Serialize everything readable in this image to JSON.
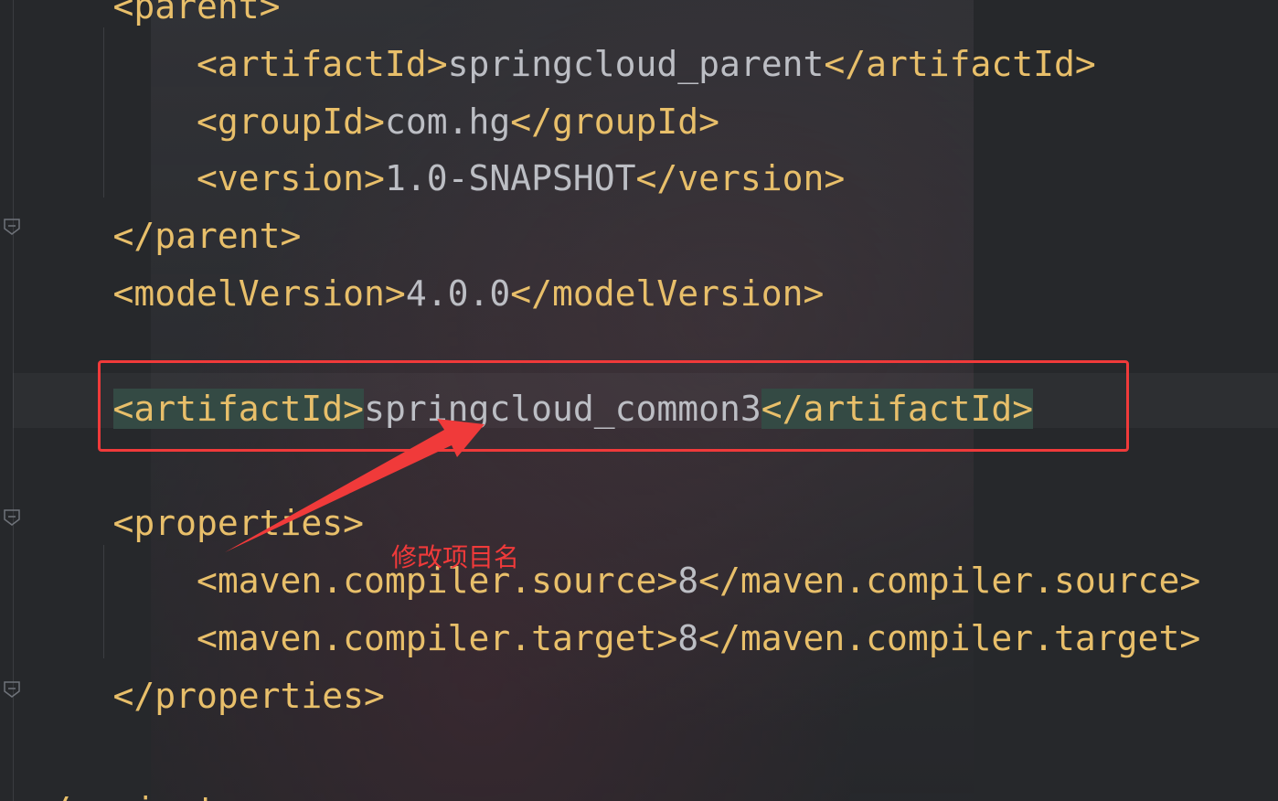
{
  "editor": {
    "lines": [
      {
        "indent": "    ",
        "parts": [
          {
            "t": "<parent>",
            "k": "tag"
          }
        ]
      },
      {
        "indent": "        ",
        "parts": [
          {
            "t": "<artifactId>",
            "k": "tag"
          },
          {
            "t": "springcloud_parent",
            "k": "val"
          },
          {
            "t": "</artifactId>",
            "k": "tag"
          }
        ]
      },
      {
        "indent": "        ",
        "parts": [
          {
            "t": "<groupId>",
            "k": "tag"
          },
          {
            "t": "com.hg",
            "k": "val"
          },
          {
            "t": "</groupId>",
            "k": "tag"
          }
        ]
      },
      {
        "indent": "        ",
        "parts": [
          {
            "t": "<version>",
            "k": "tag"
          },
          {
            "t": "1.0-SNAPSHOT",
            "k": "val"
          },
          {
            "t": "</version>",
            "k": "tag"
          }
        ]
      },
      {
        "indent": "    ",
        "parts": [
          {
            "t": "</parent>",
            "k": "tag"
          }
        ]
      },
      {
        "indent": "    ",
        "parts": [
          {
            "t": "<modelVersion>",
            "k": "tag"
          },
          {
            "t": "4.0.0",
            "k": "val"
          },
          {
            "t": "</modelVersion>",
            "k": "tag"
          }
        ]
      },
      {
        "indent": "",
        "parts": []
      },
      {
        "indent": "    ",
        "parts": [
          {
            "t": "<artifactId>",
            "k": "tag hl-tag"
          },
          {
            "t": "springcloud_common3",
            "k": "val"
          },
          {
            "t": "</artifactId>",
            "k": "tag hl-tag"
          }
        ]
      },
      {
        "indent": "",
        "parts": []
      },
      {
        "indent": "    ",
        "parts": [
          {
            "t": "<properties>",
            "k": "tag"
          }
        ]
      },
      {
        "indent": "        ",
        "parts": [
          {
            "t": "<maven.compiler.source>",
            "k": "tag"
          },
          {
            "t": "8",
            "k": "val"
          },
          {
            "t": "</maven.compiler.source>",
            "k": "tag"
          }
        ]
      },
      {
        "indent": "        ",
        "parts": [
          {
            "t": "<maven.compiler.target>",
            "k": "tag"
          },
          {
            "t": "8",
            "k": "val"
          },
          {
            "t": "</maven.compiler.target>",
            "k": "tag"
          }
        ]
      },
      {
        "indent": "    ",
        "parts": [
          {
            "t": "</properties>",
            "k": "tag"
          }
        ]
      },
      {
        "indent": "",
        "parts": []
      },
      {
        "indent": "",
        "parts": [
          {
            "t": "</project>",
            "k": "tag"
          }
        ]
      }
    ]
  },
  "annotation": {
    "text": "修改项目名",
    "color": "#f03a3a"
  },
  "colors": {
    "tag": "#e8bf6a",
    "value": "#bcbec4",
    "highlight": "#344a44",
    "background": "#26282b"
  }
}
